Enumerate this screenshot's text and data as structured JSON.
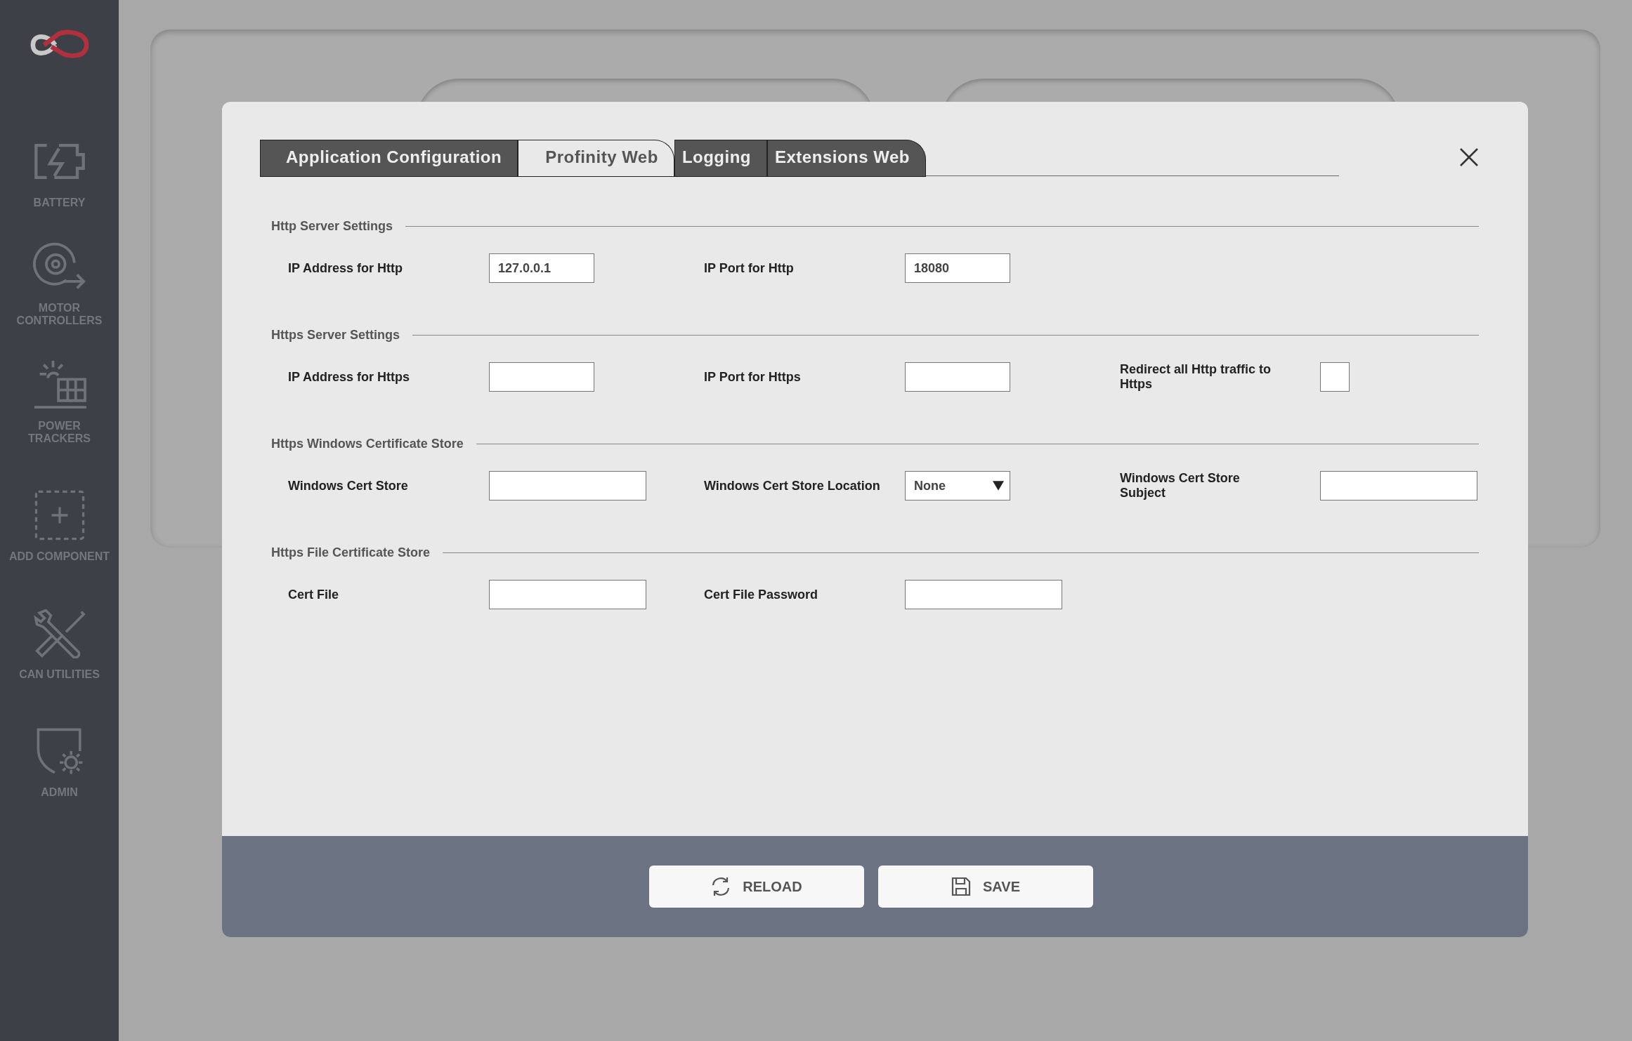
{
  "sidebar": {
    "items": [
      {
        "label": "BATTERY"
      },
      {
        "label": "MOTOR CONTROLLERS"
      },
      {
        "label": "POWER TRACKERS"
      },
      {
        "label": "ADD COMPONENT"
      },
      {
        "label": "CAN UTILITIES"
      },
      {
        "label": "ADMIN"
      }
    ]
  },
  "dialog": {
    "tabs": [
      {
        "label": "Application Configuration",
        "selected": false
      },
      {
        "label": "Profinity Web",
        "selected": true
      },
      {
        "label": "Logging",
        "selected": false
      },
      {
        "label": "Extensions Web",
        "selected": false
      }
    ],
    "sections": [
      {
        "title": "Http Server Settings",
        "fields": [
          {
            "kind": "text",
            "label": "IP Address for Http",
            "value": "127.0.0.1",
            "wide": false
          },
          {
            "kind": "text",
            "label": "IP Port for Http",
            "value": "18080",
            "wide": false
          }
        ]
      },
      {
        "title": "Https Server Settings",
        "fields": [
          {
            "kind": "text",
            "label": "IP Address for Https",
            "wide": false
          },
          {
            "kind": "text",
            "label": "IP Port for Https",
            "wide": false
          },
          {
            "kind": "checkbox",
            "label": "Redirect all Http traffic to Https",
            "checked": false
          }
        ]
      },
      {
        "title": "Https Windows Certificate Store",
        "fields": [
          {
            "kind": "text",
            "label": "Windows Cert Store",
            "wide": true
          },
          {
            "kind": "select",
            "label": "Windows Cert Store Location",
            "value": "None"
          },
          {
            "kind": "text",
            "label": "Windows Cert Store Subject",
            "wide": true
          }
        ]
      },
      {
        "title": "Https File Certificate Store",
        "fields": [
          {
            "kind": "text",
            "label": "Cert File",
            "wide": true
          },
          {
            "kind": "text",
            "label": "Cert File Password",
            "wide": true
          }
        ]
      }
    ],
    "buttons": [
      {
        "kind": "reload",
        "label": "RELOAD"
      },
      {
        "kind": "save",
        "label": "SAVE"
      }
    ]
  }
}
